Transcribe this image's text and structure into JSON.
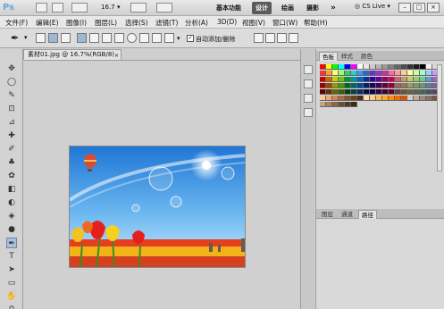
{
  "app": {
    "logo": "Ps",
    "zoom_value": "16.7",
    "workspace_buttons": [
      "基本功能",
      "设计",
      "绘画",
      "摄影"
    ],
    "workspace_active_index": 1,
    "more_label": "»",
    "cs_live": "CS Live",
    "window_buttons": [
      "–",
      "□",
      "×"
    ]
  },
  "menu": [
    "文件(F)",
    "编辑(E)",
    "图像(I)",
    "图层(L)",
    "选择(S)",
    "滤镜(T)",
    "分析(A)",
    "3D(D)",
    "视图(V)",
    "窗口(W)",
    "帮助(H)"
  ],
  "options": {
    "auto_add_delete_label": "自动添加/删除",
    "auto_add_delete_checked": true
  },
  "document": {
    "tab_title": "素材01.jpg @ 16.7%(RGB/8)",
    "close_glyph": "×"
  },
  "tools": [
    "move-icon",
    "lasso-icon",
    "quick-select-icon",
    "crop-icon",
    "eyedropper-icon",
    "healing-icon",
    "brush-icon",
    "stamp-icon",
    "history-brush-icon",
    "eraser-icon",
    "gradient-icon",
    "blur-icon",
    "dodge-icon",
    "pen-icon",
    "type-icon",
    "path-select-icon",
    "shape-icon",
    "hand-icon",
    "zoom-icon"
  ],
  "tool_glyphs": [
    "✥",
    "◯",
    "✎",
    "⊡",
    "⊿",
    "✚",
    "✐",
    "♣",
    "✿",
    "◧",
    "◐",
    "◈",
    "●",
    "✒",
    "T",
    "➤",
    "▭",
    "✋",
    "⚲"
  ],
  "active_tool_index": 13,
  "panels": {
    "upper_tabs": [
      "色板",
      "样式",
      "颜色"
    ],
    "upper_active_index": 0,
    "lower_tabs": [
      "图层",
      "通道",
      "路径"
    ],
    "lower_active_index": 2
  },
  "colors": {
    "swatch_rows": [
      [
        "#ff0000",
        "#ffff00",
        "#00ff00",
        "#00ffff",
        "#0000ff",
        "#ff00ff",
        "#ffffff",
        "#e6e6e6",
        "#cccccc",
        "#b3b3b3",
        "#999999",
        "#808080",
        "#666666",
        "#4d4d4d",
        "#333333",
        "#1a1a1a",
        "#000000",
        "#f2f2f2",
        "#d9d9d9"
      ],
      [
        "#ff3333",
        "#ff9933",
        "#ffff66",
        "#99ff66",
        "#33cc66",
        "#33cccc",
        "#3399ff",
        "#3366cc",
        "#6633cc",
        "#9933cc",
        "#cc3399",
        "#ff6699",
        "#ff9999",
        "#ffcc99",
        "#ffff99",
        "#ccff99",
        "#99ffcc",
        "#99ccff",
        "#cc99ff"
      ],
      [
        "#cc0000",
        "#cc6600",
        "#cccc00",
        "#66cc00",
        "#009933",
        "#009999",
        "#0066cc",
        "#003399",
        "#330099",
        "#660099",
        "#990066",
        "#cc0066",
        "#cc6666",
        "#cc9966",
        "#cccc66",
        "#99cc66",
        "#66cc99",
        "#6699cc",
        "#9966cc"
      ],
      [
        "#990000",
        "#994c00",
        "#999900",
        "#4c9900",
        "#006622",
        "#006666",
        "#004c99",
        "#002266",
        "#220066",
        "#440066",
        "#660044",
        "#990044",
        "#996666",
        "#997755",
        "#999966",
        "#779966",
        "#669977",
        "#667799",
        "#776699"
      ],
      [
        "#660000",
        "#663300",
        "#666600",
        "#336600",
        "#004411",
        "#004444",
        "#003366",
        "#001144",
        "#110044",
        "#330044",
        "#440033",
        "#660022",
        "#664444",
        "#665544",
        "#666644",
        "#556644",
        "#446655",
        "#445566",
        "#554466"
      ],
      [
        "#f7c89a",
        "#e8a877",
        "#c9875a",
        "#a86b43",
        "#87522f",
        "#6b3e22",
        "#4f2c17",
        "#ffe0b2",
        "#ffcc80",
        "#ffb74d",
        "#ffa726",
        "#fb8c00",
        "#ef6c00",
        "#e65100",
        "#d7ccc8",
        "#bcaaa4",
        "#a1887f",
        "#8d6e63",
        "#795548"
      ],
      [
        "#c4a27a",
        "#a7835d",
        "#8a6744",
        "#6d4e30",
        "#52391f",
        "#3a2812"
      ]
    ]
  }
}
